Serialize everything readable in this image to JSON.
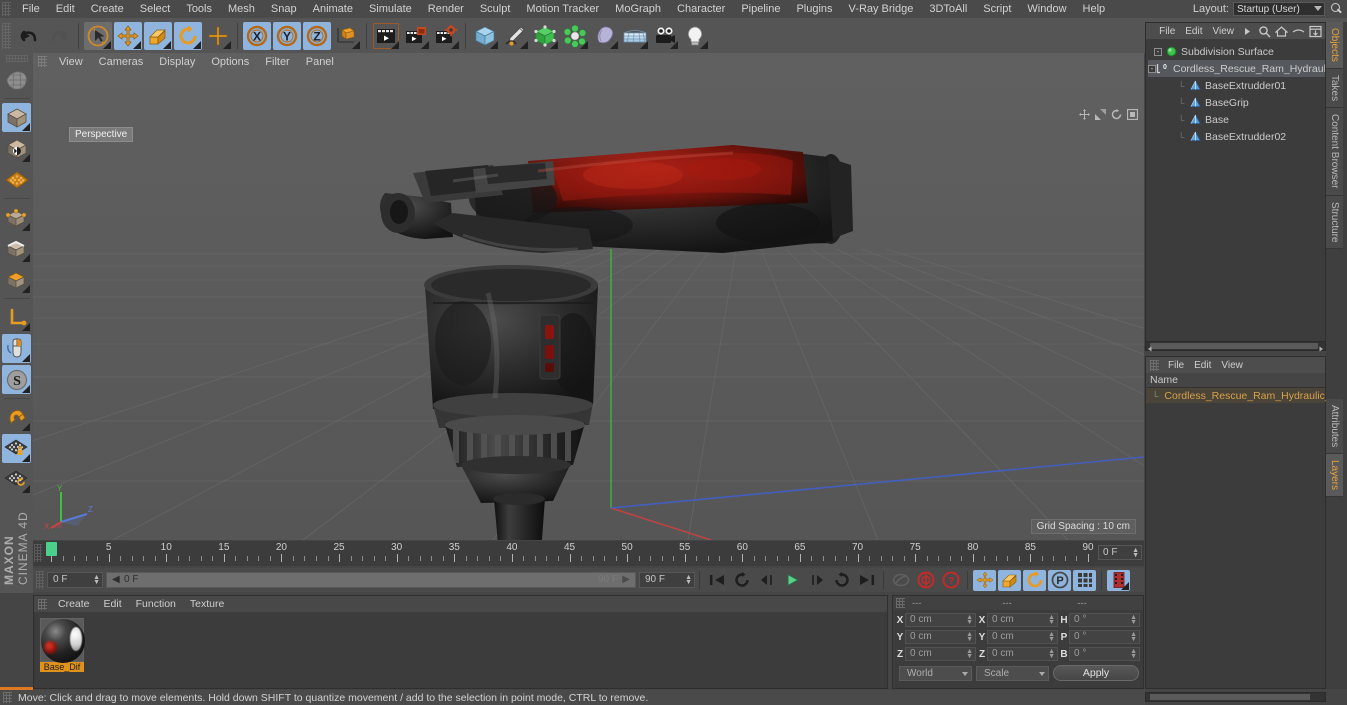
{
  "app": {
    "name": "MAXON CINEMA 4D",
    "logo_line1": "MAXON",
    "logo_line2": "CINEMA 4D"
  },
  "menubar": {
    "items": [
      "File",
      "Edit",
      "Create",
      "Select",
      "Tools",
      "Mesh",
      "Snap",
      "Animate",
      "Simulate",
      "Render",
      "Sculpt",
      "Motion Tracker",
      "MoGraph",
      "Character",
      "Pipeline",
      "Plugins",
      "V-Ray Bridge",
      "3DToAll",
      "Script",
      "Window",
      "Help"
    ],
    "layout_label": "Layout:",
    "layout_value": "Startup (User)",
    "search_icon": "search-icon"
  },
  "toolbar": {
    "groups": [
      {
        "buttons": [
          {
            "name": "undo-button",
            "icon": "undo-arrow-icon",
            "selected": false
          },
          {
            "name": "redo-button",
            "icon": "redo-arrow-icon",
            "selected": false,
            "disabled": true
          }
        ]
      },
      {
        "buttons": [
          {
            "name": "live-selection-tool",
            "icon": "cursor-circle-icon",
            "selected": false
          },
          {
            "name": "move-tool",
            "icon": "move-cross-icon",
            "selected": true
          },
          {
            "name": "scale-tool",
            "icon": "scale-box-icon",
            "selected": true
          },
          {
            "name": "rotate-tool",
            "icon": "rotate-circle-icon",
            "selected": true
          },
          {
            "name": "cursor-tool",
            "icon": "plus-cross-icon",
            "selected": false
          }
        ]
      },
      {
        "buttons": [
          {
            "name": "x-axis-lock",
            "icon": "x-axis-icon",
            "selected": true
          },
          {
            "name": "y-axis-lock",
            "icon": "y-axis-icon",
            "selected": true
          },
          {
            "name": "z-axis-lock",
            "icon": "z-axis-icon",
            "selected": true
          },
          {
            "name": "world-object-axis",
            "icon": "world-axis-icon",
            "selected": false
          }
        ]
      },
      {
        "buttons": [
          {
            "name": "render-view-button",
            "icon": "render-clapper-icon",
            "selected": false
          },
          {
            "name": "render-region-button",
            "icon": "render-region-icon",
            "selected": false
          },
          {
            "name": "render-settings-button",
            "icon": "render-gear-clapper-icon",
            "selected": false
          }
        ]
      },
      {
        "buttons": [
          {
            "name": "add-cube-button",
            "icon": "cube-icon",
            "selected": false
          },
          {
            "name": "add-spline-button",
            "icon": "pen-spline-icon",
            "selected": false
          },
          {
            "name": "add-nurbs-button",
            "icon": "green-cube-icon",
            "selected": false
          },
          {
            "name": "add-array-button",
            "icon": "atom-icon",
            "selected": false
          },
          {
            "name": "add-deformer-button",
            "icon": "bend-deformer-icon",
            "selected": false
          },
          {
            "name": "add-environment-button",
            "icon": "floor-grid-icon",
            "selected": false
          },
          {
            "name": "add-camera-button",
            "icon": "camera-icon",
            "selected": false
          },
          {
            "name": "add-light-button",
            "icon": "light-bulb-icon",
            "selected": false
          }
        ]
      }
    ]
  },
  "left_toolbar": {
    "buttons": [
      {
        "name": "make-editable-button",
        "icon": "make-editable-icon",
        "selected": false
      },
      {
        "name": "model-mode-button",
        "icon": "model-cube-icon",
        "selected": true
      },
      {
        "name": "texture-mode-button",
        "icon": "texture-cube-icon",
        "selected": false
      },
      {
        "name": "workplane-mode-button",
        "icon": "workplane-grid-icon",
        "selected": false
      },
      {
        "name": "point-mode-button",
        "icon": "point-cube-icon",
        "selected": false
      },
      {
        "name": "edge-mode-button",
        "icon": "edge-cube-icon",
        "selected": false
      },
      {
        "name": "polygon-mode-button",
        "icon": "polygon-cube-icon",
        "selected": false
      },
      {
        "name": "axis-mode-button",
        "icon": "axis-corner-icon",
        "selected": false
      },
      {
        "name": "viewport-solo-button",
        "icon": "mouse-icon",
        "selected": true
      },
      {
        "name": "enable-snap-button",
        "icon": "s-circle-icon",
        "selected": true
      },
      {
        "name": "magnet-tool-button",
        "icon": "magnet-icon",
        "selected": false
      },
      {
        "name": "workplane-lock-button",
        "icon": "grid-lock-icon",
        "selected": true
      },
      {
        "name": "workplane-reset-button",
        "icon": "grid-reset-icon",
        "selected": false
      }
    ]
  },
  "viewport": {
    "menu_items": [
      "View",
      "Cameras",
      "Display",
      "Options",
      "Filter",
      "Panel"
    ],
    "view_label": "Perspective",
    "grid_spacing": "Grid Spacing : 10 cm",
    "axis_labels": {
      "x": "X",
      "y": "Y",
      "z": "Z"
    },
    "nav_icons": [
      "move-view-icon",
      "scale-view-icon",
      "rotate-view-icon",
      "maximize-view-icon"
    ]
  },
  "object_manager": {
    "tab": "Objects",
    "menu": [
      "File",
      "Edit",
      "View"
    ],
    "icons": [
      "more-arrow-icon",
      "search-icon",
      "home-icon",
      "eye-icon",
      "fit-icon"
    ],
    "tree": [
      {
        "label": "Subdivision Surface",
        "depth": 0,
        "icon": "subdivision-surface-icon",
        "selected": false,
        "expander": "-"
      },
      {
        "label": "Cordless_Rescue_Ram_Hydraulic_",
        "depth": 1,
        "icon": "layer-zero-icon",
        "selected": true,
        "expander": "-"
      },
      {
        "label": "BaseExtrudder01",
        "depth": 2,
        "icon": "polygon-object-icon",
        "selected": false,
        "expander": ""
      },
      {
        "label": "BaseGrip",
        "depth": 2,
        "icon": "polygon-object-icon",
        "selected": false,
        "expander": ""
      },
      {
        "label": "Base",
        "depth": 2,
        "icon": "polygon-object-icon",
        "selected": false,
        "expander": ""
      },
      {
        "label": "BaseExtrudder02",
        "depth": 2,
        "icon": "polygon-object-icon",
        "selected": false,
        "expander": ""
      }
    ]
  },
  "attribute_manager": {
    "tab": "Attributes",
    "menu": [
      "File",
      "Edit",
      "View"
    ],
    "column_header": "Name",
    "rows": [
      {
        "label": "Cordless_Rescue_Ram_Hydraulic_L",
        "color": "#d6a24a",
        "swatch": "#e08a20"
      }
    ]
  },
  "vertical_tabs": [
    {
      "label": "Objects",
      "active": true
    },
    {
      "label": "Takes",
      "active": false
    },
    {
      "label": "Content Browser",
      "active": false
    },
    {
      "label": "Structure",
      "active": false
    },
    {
      "label": "Attributes",
      "active": false
    },
    {
      "label": "Layers",
      "active": true
    }
  ],
  "timeline": {
    "start": 0,
    "end": 90,
    "major_step": 5,
    "labels": [
      "0",
      "5",
      "10",
      "15",
      "20",
      "25",
      "30",
      "35",
      "40",
      "45",
      "50",
      "55",
      "60",
      "65",
      "70",
      "75",
      "80",
      "85",
      "90"
    ],
    "current_frame": "0 F",
    "playhead_frame": 0
  },
  "playbar": {
    "current_frame_field": "0 F",
    "slider_start_label": "0 F",
    "slider_end_label": "90 F",
    "end_frame_field": "90 F",
    "buttons": [
      {
        "name": "go-to-start-button",
        "icon": "skip-start-icon",
        "selected": false
      },
      {
        "name": "previous-key-button",
        "icon": "prev-key-icon",
        "selected": false
      },
      {
        "name": "step-back-button",
        "icon": "step-back-icon",
        "selected": false
      },
      {
        "name": "play-button",
        "icon": "play-icon",
        "selected": false
      },
      {
        "name": "step-forward-button",
        "icon": "step-forward-icon",
        "selected": false
      },
      {
        "name": "next-key-button",
        "icon": "next-key-icon",
        "selected": false
      },
      {
        "name": "go-to-end-button",
        "icon": "skip-end-icon",
        "selected": false
      },
      {
        "name": "loop-button",
        "icon": "loop-icon",
        "selected": false,
        "disabled": true
      },
      {
        "name": "record-active-objects-button",
        "icon": "record-icon",
        "selected": false
      },
      {
        "name": "autokeying-button",
        "icon": "autokey-icon",
        "selected": false
      },
      {
        "name": "key-position-button",
        "icon": "key-position-icon",
        "selected": true
      },
      {
        "name": "key-scale-button",
        "icon": "key-scale-icon",
        "selected": true
      },
      {
        "name": "key-rotation-button",
        "icon": "key-rotation-icon",
        "selected": true
      },
      {
        "name": "key-parameter-button",
        "icon": "key-param-icon",
        "selected": true
      },
      {
        "name": "key-pla-button",
        "icon": "key-pla-icon",
        "selected": true
      },
      {
        "name": "timeline-button",
        "icon": "timeline-strip-icon",
        "selected": true
      }
    ]
  },
  "material_manager": {
    "menu": [
      "Create",
      "Edit",
      "Function",
      "Texture"
    ],
    "materials": [
      {
        "name": "Base_Dif",
        "selected": true
      }
    ]
  },
  "coordinates": {
    "headers": [
      "---",
      "---",
      "---"
    ],
    "position_label": "X",
    "rows": [
      {
        "labels": [
          "X",
          "X",
          "H"
        ],
        "values": [
          "0 cm",
          "0 cm",
          "0 °"
        ]
      },
      {
        "labels": [
          "Y",
          "Y",
          "P"
        ],
        "values": [
          "0 cm",
          "0 cm",
          "0 °"
        ]
      },
      {
        "labels": [
          "Z",
          "Z",
          "B"
        ],
        "values": [
          "0 cm",
          "0 cm",
          "0 °"
        ]
      }
    ],
    "coord_system": "World",
    "size_mode": "Scale",
    "apply_label": "Apply"
  },
  "statusbar": {
    "text": "Move: Click and drag to move elements. Hold down SHIFT to quantize movement / add to the selection in point mode, CTRL to remove."
  },
  "colors": {
    "accent_orange": "#e08a20",
    "selection_blue": "#8fb4dd",
    "playhead_green": "#4ad08a",
    "panel_bg": "#3c3c3c",
    "toolbar_bg": "#555555",
    "viewport_bg": "#5b5b5b"
  }
}
